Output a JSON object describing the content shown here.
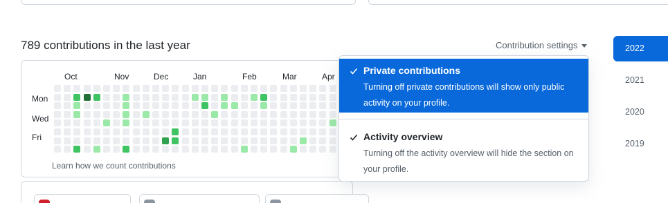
{
  "heading": "789 contributions in the last year",
  "settings_label": "Contribution settings",
  "months": [
    "Oct",
    "Nov",
    "Dec",
    "Jan",
    "Feb",
    "Mar",
    "Apr"
  ],
  "days": [
    "Mon",
    "Wed",
    "Fri"
  ],
  "learn_link": "Learn how we count contributions",
  "years": [
    "2022",
    "2021",
    "2020",
    "2019"
  ],
  "active_year": "2022",
  "menu": {
    "items": [
      {
        "title": "Private contributions",
        "description": "Turning off private contributions will show only public activity on your profile.",
        "checked": true,
        "selected": true
      },
      {
        "title": "Activity overview",
        "description": "Turning off the activity overview will hide the section on your profile.",
        "checked": true,
        "selected": false
      }
    ]
  },
  "colors": {
    "accent": "#0969da",
    "level0": "#ebedf0",
    "level1": "#9be9a8",
    "level2": "#40c463",
    "level3": "#30a14e",
    "level4": "#216e39"
  },
  "contribution_grid": [
    [
      0,
      0,
      0,
      0,
      0,
      0,
      0,
      0,
      0,
      0,
      0,
      0,
      0,
      0,
      0,
      0,
      0,
      0,
      0,
      0,
      0,
      0,
      0,
      0,
      0,
      0,
      0,
      0,
      0,
      0,
      0
    ],
    [
      0,
      0,
      2,
      4,
      2,
      0,
      0,
      1,
      0,
      0,
      0,
      0,
      0,
      0,
      1,
      1,
      0,
      1,
      0,
      0,
      1,
      2,
      0,
      0,
      0,
      0,
      0,
      0,
      0,
      0,
      0
    ],
    [
      0,
      0,
      1,
      0,
      0,
      0,
      0,
      1,
      0,
      0,
      0,
      0,
      0,
      0,
      0,
      2,
      0,
      1,
      1,
      0,
      0,
      1,
      0,
      0,
      0,
      0,
      0,
      0,
      0,
      0,
      0
    ],
    [
      0,
      0,
      1,
      0,
      0,
      0,
      0,
      1,
      0,
      1,
      0,
      0,
      0,
      0,
      0,
      0,
      1,
      0,
      0,
      0,
      0,
      0,
      0,
      0,
      0,
      0,
      0,
      0,
      0,
      0,
      0
    ],
    [
      0,
      0,
      0,
      0,
      0,
      1,
      0,
      1,
      0,
      0,
      0,
      0,
      0,
      0,
      0,
      0,
      0,
      0,
      0,
      0,
      0,
      0,
      0,
      0,
      0,
      0,
      0,
      0,
      1,
      1,
      0
    ],
    [
      0,
      0,
      0,
      0,
      0,
      0,
      0,
      0,
      0,
      0,
      0,
      0,
      2,
      0,
      0,
      0,
      0,
      0,
      0,
      0,
      0,
      0,
      0,
      0,
      0,
      0,
      0,
      0,
      0,
      1,
      0
    ],
    [
      0,
      0,
      0,
      0,
      0,
      0,
      0,
      0,
      0,
      0,
      0,
      3,
      2,
      0,
      0,
      0,
      0,
      0,
      0,
      0,
      0,
      0,
      0,
      0,
      0,
      1,
      0,
      0,
      0,
      0,
      1
    ],
    [
      0,
      0,
      2,
      0,
      1,
      0,
      0,
      2,
      0,
      0,
      0,
      0,
      0,
      0,
      0,
      0,
      0,
      0,
      0,
      1,
      0,
      0,
      0,
      0,
      1,
      0,
      0,
      0,
      0,
      1,
      0
    ]
  ]
}
